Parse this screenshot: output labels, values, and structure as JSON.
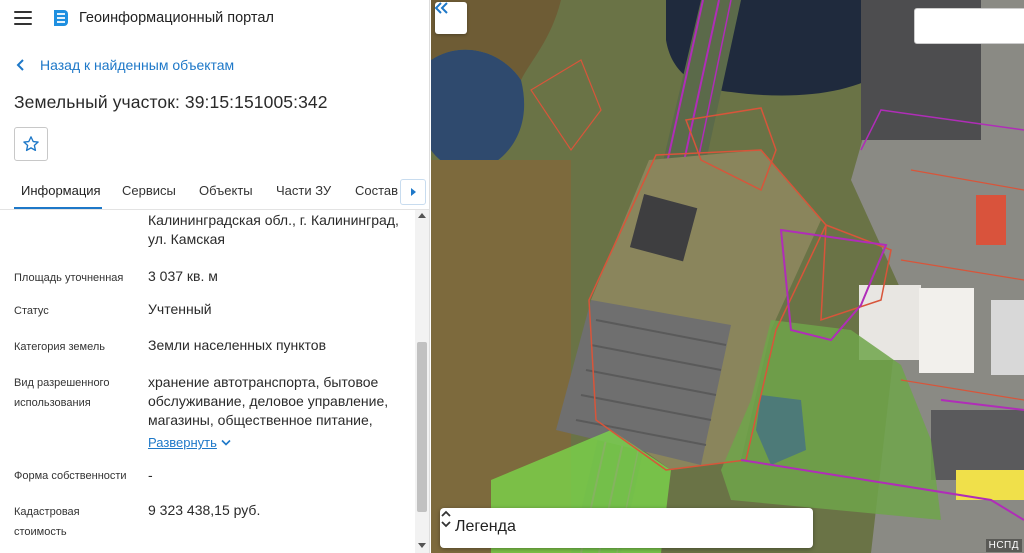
{
  "app": {
    "title": "Геоинформационный портал"
  },
  "nav": {
    "back_label": "Назад к найденным объектам"
  },
  "object": {
    "title": "Земельный участок: 39:15:151005:342"
  },
  "tabs": [
    {
      "label": "Информация",
      "active": true
    },
    {
      "label": "Сервисы"
    },
    {
      "label": "Объекты"
    },
    {
      "label": "Части ЗУ"
    },
    {
      "label": "Состав"
    }
  ],
  "details": {
    "address_value": "Калининградская обл., г. Калининград, ул. Камская",
    "area_label": "Площадь уточненная",
    "area_value": "3 037 кв. м",
    "status_label": "Статус",
    "status_value": "Учтенный",
    "category_label": "Категория земель",
    "category_value": "Земли населенных пунктов",
    "use_label": "Вид разрешенного использования",
    "use_value": "хранение автотранспорта, бытовое обслуживание, деловое управление, магазины, общественное питание,",
    "expand_label": "Развернуть",
    "ownership_label": "Форма собственности",
    "ownership_value": "-",
    "cadastral_label": "Кадастровая стоимость",
    "cadastral_value": "9 323 438,15 руб."
  },
  "map": {
    "legend_label": "Легенда",
    "attribution": "НСПД"
  },
  "colors": {
    "accent": "#1e78c8",
    "parcel_border": "#d8553a",
    "zone_border": "#b02db8",
    "highlight": "#7ad44a"
  },
  "icons": [
    "menu-icon",
    "portal-logo-icon",
    "chevron-left-icon",
    "star-icon",
    "chevron-right-icon",
    "chevron-down-icon",
    "double-chevron-left-icon",
    "updown-icon"
  ]
}
